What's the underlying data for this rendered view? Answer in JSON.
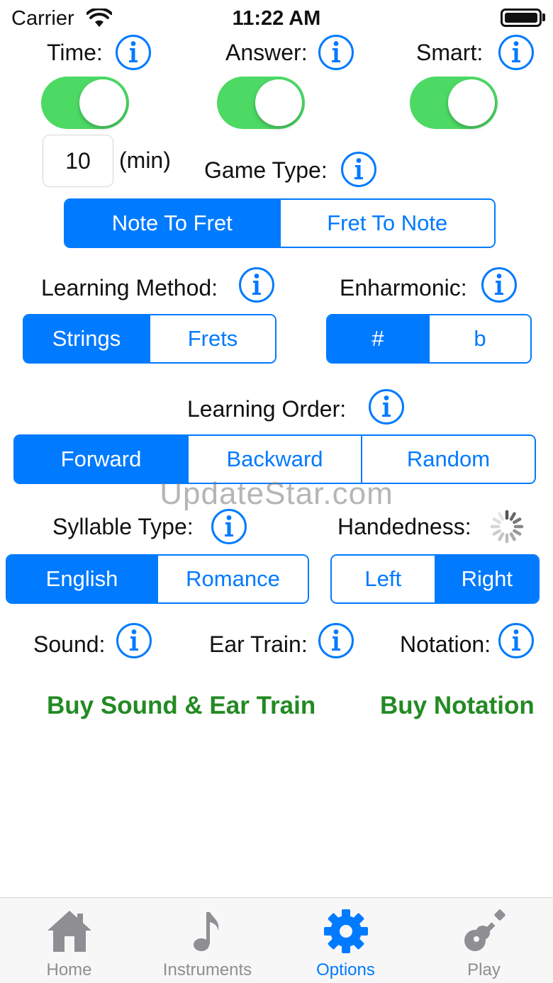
{
  "status_bar": {
    "carrier": "Carrier",
    "time": "11:22 AM"
  },
  "toggles": [
    {
      "label": "Time:",
      "on": true
    },
    {
      "label": "Answer:",
      "on": true
    },
    {
      "label": "Smart:",
      "on": true
    }
  ],
  "time_limit": {
    "value": "10",
    "unit": "(min)"
  },
  "game_type": {
    "label": "Game Type:",
    "options": [
      "Note To Fret",
      "Fret To Note"
    ],
    "selected": "Note To Fret"
  },
  "learning_method": {
    "label": "Learning Method:",
    "options": [
      "Strings",
      "Frets"
    ],
    "selected": "Strings"
  },
  "enharmonic": {
    "label": "Enharmonic:",
    "options": [
      "#",
      "b"
    ],
    "selected": "#"
  },
  "learning_order": {
    "label": "Learning Order:",
    "options": [
      "Forward",
      "Backward",
      "Random"
    ],
    "selected": "Forward"
  },
  "watermark": "UpdateStar.com",
  "syllable_type": {
    "label": "Syllable Type:",
    "options": [
      "English",
      "Romance"
    ],
    "selected": "English"
  },
  "handedness": {
    "label": "Handedness:",
    "options": [
      "Left",
      "Right"
    ],
    "selected": "Right"
  },
  "sound": {
    "label": "Sound:"
  },
  "ear_train": {
    "label": "Ear Train:"
  },
  "notation": {
    "label": "Notation:"
  },
  "buy": {
    "sound_ear_train": "Buy Sound & Ear Train",
    "notation": "Buy Notation"
  },
  "tabs": [
    {
      "label": "Home",
      "icon": "home-icon",
      "active": false
    },
    {
      "label": "Instruments",
      "icon": "music-note-icon",
      "active": false
    },
    {
      "label": "Options",
      "icon": "gear-icon",
      "active": true
    },
    {
      "label": "Play",
      "icon": "guitar-icon",
      "active": false
    }
  ],
  "colors": {
    "accent": "#007aff",
    "toggle_on": "#4cd964",
    "buy_green": "#238a23",
    "tab_inactive": "#8e8e93"
  }
}
